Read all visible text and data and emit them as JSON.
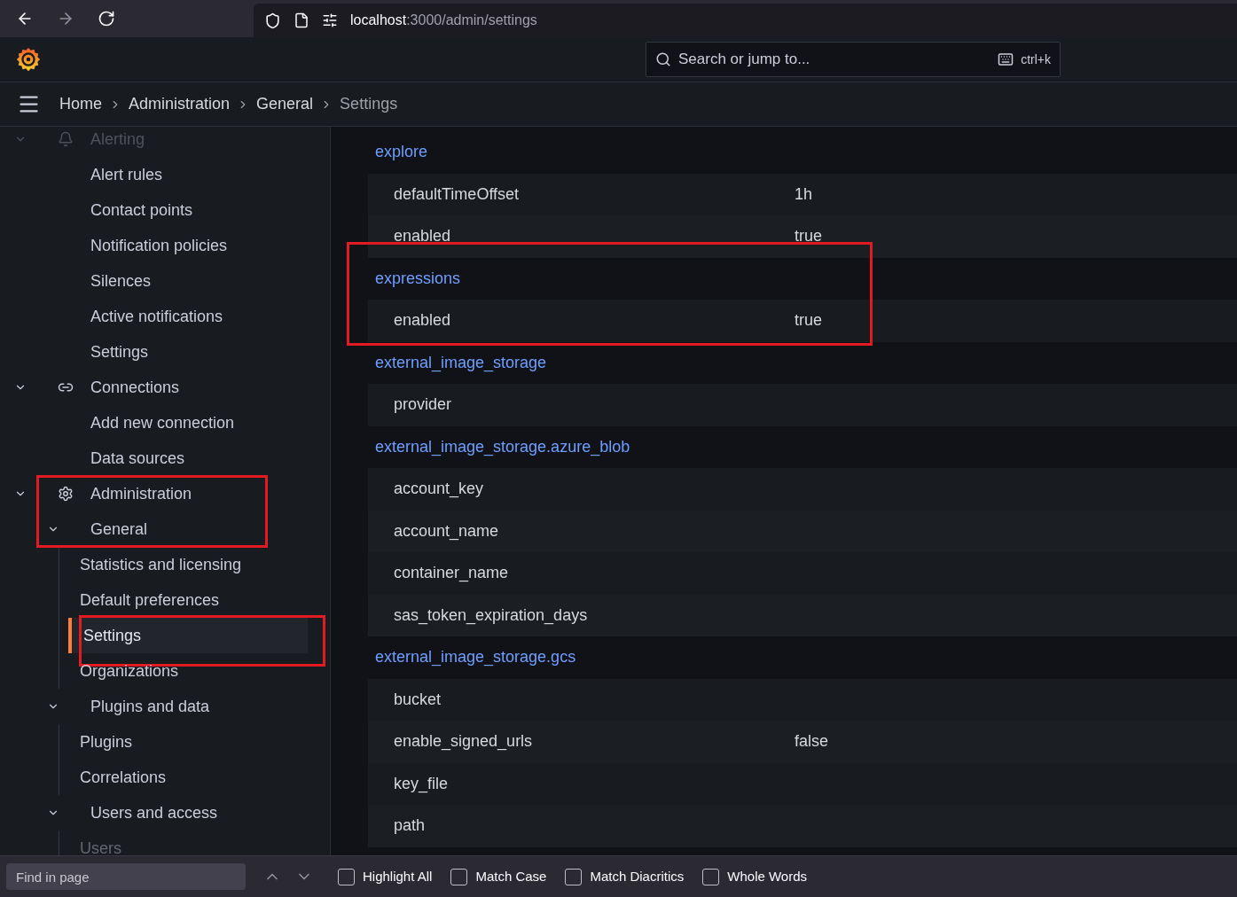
{
  "browser": {
    "url_host": "localhost",
    "url_path": ":3000/admin/settings"
  },
  "topbar": {
    "search_placeholder": "Search or jump to...",
    "shortcut": "ctrl+k"
  },
  "breadcrumbs": [
    {
      "label": "Home",
      "current": false
    },
    {
      "label": "Administration",
      "current": false
    },
    {
      "label": "General",
      "current": false
    },
    {
      "label": "Settings",
      "current": true
    }
  ],
  "sidebar": {
    "items": [
      {
        "label": "Alerting",
        "expanded": true,
        "faded": true,
        "highlighted": false,
        "children": [
          {
            "label": "Alert rules",
            "selected": false
          },
          {
            "label": "Contact points",
            "selected": false
          },
          {
            "label": "Notification policies",
            "selected": false
          },
          {
            "label": "Silences",
            "selected": false
          },
          {
            "label": "Active notifications",
            "selected": false
          },
          {
            "label": "Settings",
            "selected": false
          }
        ]
      },
      {
        "label": "Connections",
        "expanded": true,
        "faded": false,
        "highlighted": false,
        "children": [
          {
            "label": "Add new connection",
            "selected": false
          },
          {
            "label": "Data sources",
            "selected": false
          }
        ]
      },
      {
        "label": "Administration",
        "expanded": true,
        "faded": false,
        "highlighted": true,
        "children": [
          {
            "label": "General",
            "expanded": true,
            "children": [
              {
                "label": "Statistics and licensing",
                "selected": false,
                "highlighted": false,
                "faded": false
              },
              {
                "label": "Default preferences",
                "selected": false,
                "highlighted": false,
                "faded": false
              },
              {
                "label": "Settings",
                "selected": true,
                "highlighted": true,
                "faded": false
              },
              {
                "label": "Organizations",
                "selected": false,
                "highlighted": false,
                "faded": false
              }
            ]
          },
          {
            "label": "Plugins and data",
            "expanded": true,
            "children": [
              {
                "label": "Plugins",
                "selected": false,
                "highlighted": false,
                "faded": false
              },
              {
                "label": "Correlations",
                "selected": false,
                "highlighted": false,
                "faded": false
              }
            ]
          },
          {
            "label": "Users and access",
            "expanded": true,
            "children": [
              {
                "label": "Users",
                "selected": false,
                "highlighted": false,
                "faded": true
              }
            ]
          }
        ]
      }
    ]
  },
  "settings": [
    {
      "section": "explore",
      "highlighted": false,
      "rows": [
        {
          "key": "defaultTimeOffset",
          "value": "1h"
        },
        {
          "key": "enabled",
          "value": "true"
        }
      ]
    },
    {
      "section": "expressions",
      "highlighted": true,
      "rows": [
        {
          "key": "enabled",
          "value": "true"
        }
      ]
    },
    {
      "section": "external_image_storage",
      "highlighted": false,
      "rows": [
        {
          "key": "provider"
        }
      ]
    },
    {
      "section": "external_image_storage.azure_blob",
      "highlighted": false,
      "rows": [
        {
          "key": "account_key"
        },
        {
          "key": "account_name"
        },
        {
          "key": "container_name"
        },
        {
          "key": "sas_token_expiration_days"
        }
      ]
    },
    {
      "section": "external_image_storage.gcs",
      "highlighted": false,
      "rows": [
        {
          "key": "bucket"
        },
        {
          "key": "enable_signed_urls",
          "value": "false"
        },
        {
          "key": "key_file"
        },
        {
          "key": "path"
        }
      ]
    }
  ],
  "find_bar": {
    "placeholder": "Find in page",
    "options": [
      {
        "label": "Highlight All",
        "checked": false
      },
      {
        "label": "Match Case",
        "checked": false
      },
      {
        "label": "Match Diacritics",
        "checked": false
      },
      {
        "label": "Whole Words",
        "checked": false
      }
    ]
  }
}
